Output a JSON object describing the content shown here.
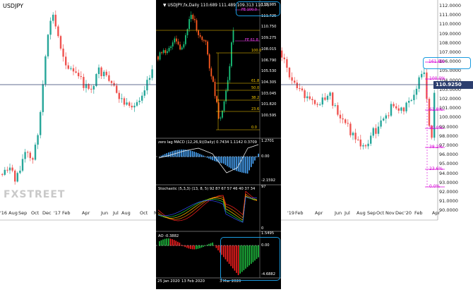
{
  "main": {
    "symbol": "USDJPY",
    "price_ticks": [
      "112.0000",
      "111.0000",
      "110.0000",
      "109.0000",
      "108.0000",
      "107.0000",
      "106.0000",
      "105.0000",
      "104.0000",
      "103.0000",
      "102.0000",
      "101.0000",
      "100.0000",
      "99.0000",
      "98.0000",
      "97.0000",
      "96.0000",
      "95.0000",
      "94.0000",
      "93.0000",
      "92.0000",
      "91.0000",
      "90.0000"
    ],
    "current_price": "110.9250",
    "fib_labels": [
      "161.8%",
      "100.0%",
      "61.8%",
      "50.0%",
      "38.2%",
      "23.6%",
      "0.0%"
    ],
    "x_ticks": [
      "'16 Aug",
      "Sep",
      "Oct",
      "Dec",
      "'17",
      "Feb",
      "Apr",
      "Jun",
      "Jul",
      "Aug",
      "Oct",
      "Nov",
      "Dec",
      "'19",
      "Feb",
      "Apr",
      "Jun",
      "Jul",
      "Aug",
      "Sep",
      "Oct",
      "Nov",
      "Dec",
      "'20",
      "Feb",
      "Apr"
    ],
    "logo": "FXSTREET"
  },
  "inset": {
    "title": "USDJPY,fx,Daily  110.689 111.489 109.313 110.75",
    "price_labels": [
      "112.985",
      "111.725",
      "110.750",
      "109.275",
      "108.015",
      "106.790",
      "105.530",
      "104.305",
      "103.045",
      "101.820",
      "100.595"
    ],
    "fib_labels": [
      "61.8",
      "50.0",
      "38.2",
      "23.6",
      "0.0",
      "100.0"
    ],
    "fib_magenta": [
      "FE 100.0",
      "FE 61.8"
    ],
    "macd": {
      "title": "zero lag MACD (12,26,9)(Daily) 0.7434 1.1142 0.3709",
      "labels": [
        "1.2701",
        "0.00",
        "-2.1592"
      ]
    },
    "stoch": {
      "title": "Stochastic (5,3,3) (13, 8, 5) 92 87 67 57 46 40 37 34",
      "labels": [
        "97",
        "0"
      ]
    },
    "ao": {
      "title": "AO -0.3882",
      "labels": [
        "1.5495",
        "0.00",
        "-4.6882"
      ]
    },
    "x_ticks": [
      "25 Jan 2020",
      "13 Feb 2020",
      "3 Mar 2020"
    ]
  },
  "colors": {
    "bull": "#26a69a",
    "bear": "#ef5350",
    "fib": "#d800d8",
    "callout": "#1a9be0"
  }
}
